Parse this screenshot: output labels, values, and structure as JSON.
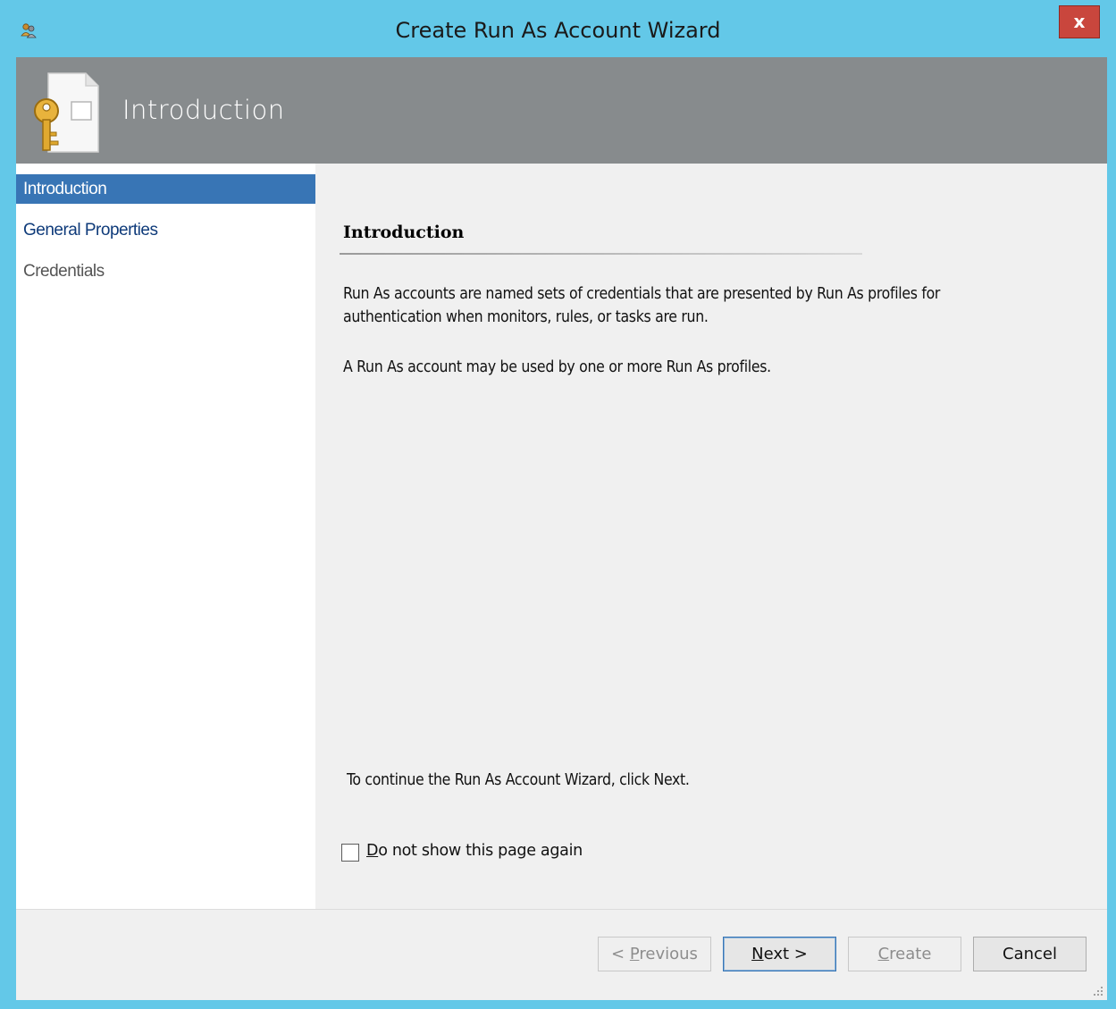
{
  "window": {
    "title": "Create Run As Account Wizard",
    "close_label": "x",
    "accent": "#63c8e8",
    "close_color": "#c9463d"
  },
  "banner": {
    "title": "Introduction",
    "icon": "key-document-icon",
    "background": "#878b8d"
  },
  "sidebar": {
    "items": [
      {
        "label": "Introduction",
        "state": "active"
      },
      {
        "label": "General Properties",
        "state": "link"
      },
      {
        "label": "Credentials",
        "state": "disabled"
      }
    ],
    "active_color": "#3875b5"
  },
  "main": {
    "heading": "Introduction",
    "paragraph1_line1": "Run As accounts are named sets of credentials that are presented by Run As profiles for",
    "paragraph1_line2": "authentication when monitors, rules, or tasks are run.",
    "paragraph2": "A Run As account may be used by one or more Run As profiles.",
    "continue_text": "To continue the Run As Account Wizard, click Next.",
    "checkbox": {
      "accel": "D",
      "label_rest": "o not show this page again",
      "checked": false
    }
  },
  "footer": {
    "previous": {
      "prefix": "< ",
      "accel": "P",
      "rest": "revious",
      "enabled": false
    },
    "next": {
      "accel": "N",
      "rest": "ext >",
      "enabled": true
    },
    "create": {
      "accel": "C",
      "rest": "reate",
      "enabled": false
    },
    "cancel": {
      "label": "Cancel",
      "enabled": true
    }
  }
}
